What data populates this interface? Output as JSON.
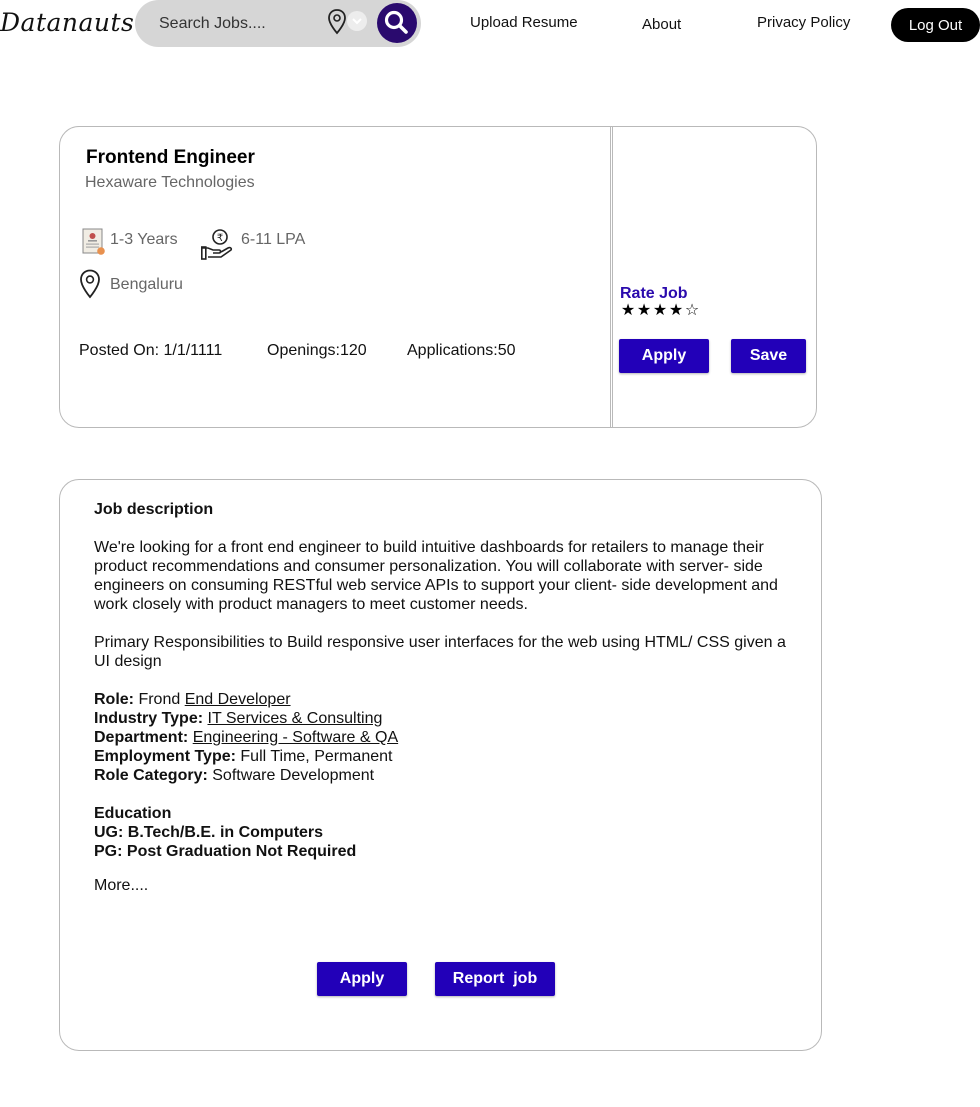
{
  "header": {
    "logo": "Datanauts",
    "search_placeholder": "Search Jobs....",
    "nav": [
      "Upload Resume",
      "About",
      "Privacy Policy"
    ],
    "logout": "Log Out"
  },
  "job": {
    "title": "Frontend Engineer",
    "company": "Hexaware Technologies",
    "experience": "1-3 Years",
    "salary": "6-11 LPA",
    "location": "Bengaluru",
    "posted": "Posted On: 1/1/1111",
    "openings": "Openings:120",
    "applications": "Applications:50",
    "rate_label": "Rate Job",
    "rating": 4,
    "rating_max": 5,
    "apply": "Apply",
    "save": "Save"
  },
  "description": {
    "heading": "Job description",
    "para1": "We're looking for a front end engineer to build intuitive dashboards for retailers to manage their product recommendations and consumer personalization. You will collaborate with server- side engineers on consuming RESTful web service APIs to support your client- side development and work closely with product managers to meet customer needs.",
    "para2": "Primary Responsibilities to Build responsive user interfaces for the web using HTML/ CSS given a UI design",
    "role_label": "Role:",
    "role_plain": "Frond",
    "role_link": "End Developer",
    "industry_label": "Industry Type:",
    "industry_value": "IT Services & Consulting",
    "department_label": "Department:",
    "department_value": "Engineering - Software & QA",
    "employment_label": "Employment Type:",
    "employment_value": "Full Time, Permanent",
    "category_label": "Role Category:",
    "category_value": "Software Development",
    "education_heading": "Education",
    "ug": "UG: B.Tech/B.E. in Computers",
    "pg": "PG: Post Graduation Not Required",
    "more": "More....",
    "apply": "Apply",
    "report": "Report  job"
  },
  "colors": {
    "accent": "#2200b8",
    "search_button": "#2a0a6e",
    "rate_label": "#2a0aad"
  }
}
